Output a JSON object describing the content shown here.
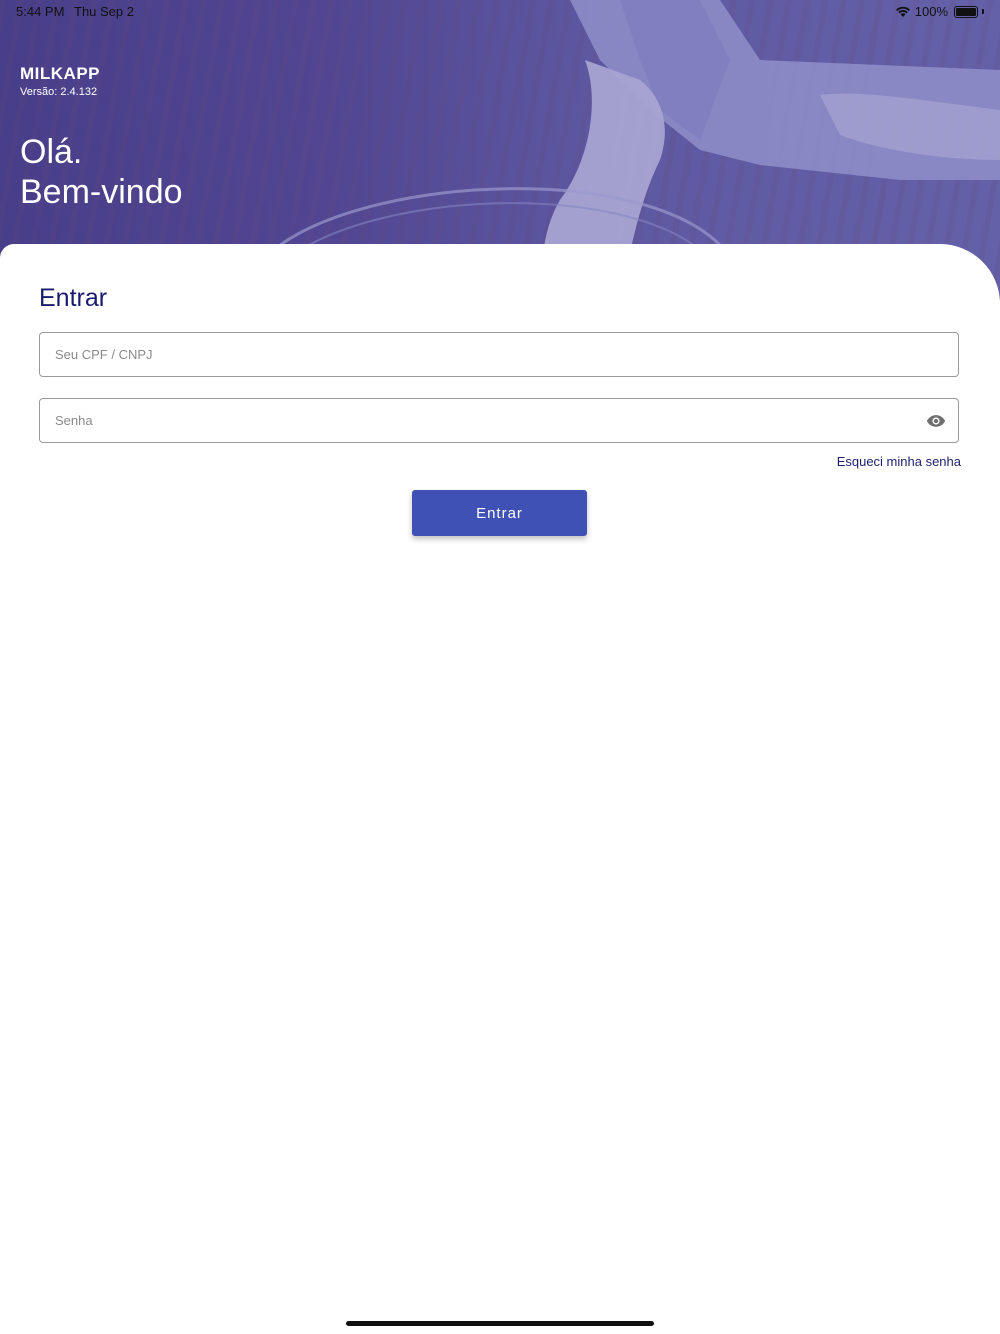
{
  "status_bar": {
    "time": "5:44 PM",
    "date": "Thu Sep 2",
    "battery_text": "100%"
  },
  "header": {
    "logo_text": "MILKAPP",
    "version_text": "Versão: 2.4.132",
    "greeting_line1": "Olá.",
    "greeting_line2": "Bem-vindo"
  },
  "login": {
    "title": "Entrar",
    "cpf_placeholder": "Seu CPF / CNPJ",
    "cpf_value": "",
    "password_placeholder": "Senha",
    "password_value": "",
    "forgot_label": "Esqueci minha senha",
    "submit_label": "Entrar"
  },
  "icons": {
    "wifi": "wifi-icon",
    "battery": "battery-icon",
    "toggle_password": "eye-icon"
  },
  "colors": {
    "primary_button": "#3f51b5",
    "title_text": "#1a1a6e",
    "header_tint": "#5a4d92"
  }
}
